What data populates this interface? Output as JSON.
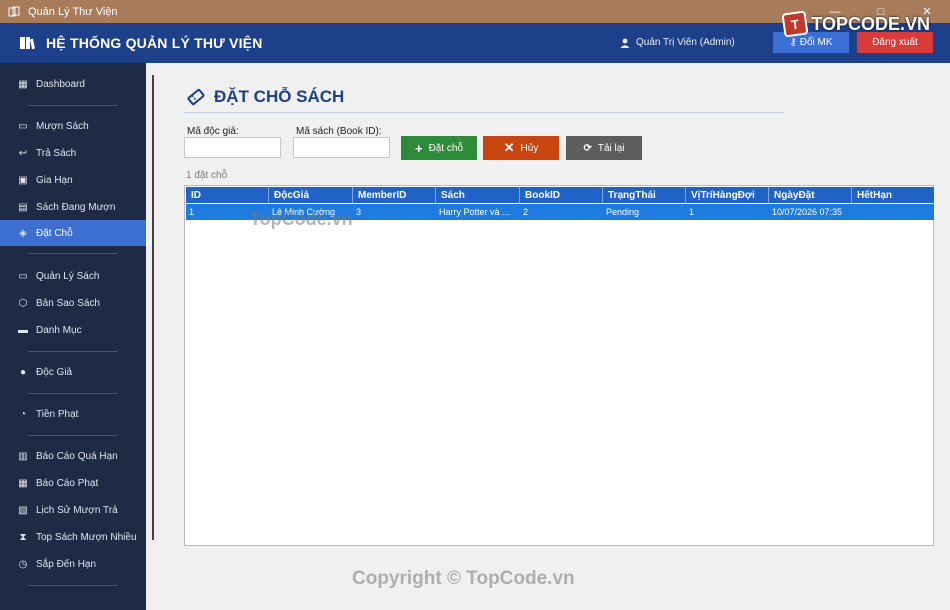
{
  "window": {
    "title": "Quản Lý Thư Viện",
    "controls": [
      "—",
      "□",
      "✕"
    ]
  },
  "brand": {
    "logo_text": "TOPCODE.VN"
  },
  "header": {
    "title": "HỆ THỐNG QUẢN LÝ THƯ VIỆN",
    "user_label": "Quản Trị Viên  (Admin)",
    "change_pw_label": "Đổi MK",
    "logout_label": "Đăng xuất"
  },
  "sidebar": {
    "items": [
      {
        "label": "Dashboard",
        "icon": "chart-icon"
      },
      {
        "label": "Mượn Sách",
        "icon": "book-icon"
      },
      {
        "label": "Trả Sách",
        "icon": "return-icon"
      },
      {
        "label": "Gia Hạn",
        "icon": "calendar-icon"
      },
      {
        "label": "Sách Đang Mượn",
        "icon": "list-icon"
      },
      {
        "label": "Đặt Chỗ",
        "icon": "ticket-icon",
        "active": true
      },
      {
        "label": "Quản Lý Sách",
        "icon": "book-icon"
      },
      {
        "label": "Bản Sao Sách",
        "icon": "box-icon"
      },
      {
        "label": "Danh Mục",
        "icon": "folder-icon"
      },
      {
        "label": "Độc Giả",
        "icon": "user-icon"
      },
      {
        "label": "Tiền Phạt",
        "icon": "stopwatch-icon"
      },
      {
        "label": "Báo Cáo Quá Hạn",
        "icon": "report-icon"
      },
      {
        "label": "Báo Cáo Phạt",
        "icon": "chart-icon"
      },
      {
        "label": "Lịch Sử Mượn Trả",
        "icon": "history-icon"
      },
      {
        "label": "Top Sách Mượn Nhiều",
        "icon": "trophy-icon"
      },
      {
        "label": "Sắp Đến Hạn",
        "icon": "alarm-icon"
      }
    ]
  },
  "main": {
    "title": "ĐẶT CHỖ SÁCH",
    "reader_label": "Mã độc giả:",
    "reader_value": "",
    "book_label": "Mã sách (Book ID):",
    "book_value": "",
    "add_label": "Đặt chỗ",
    "cancel_label": "Hủy",
    "reload_label": "Tải lại",
    "count_text": "1 đặt chỗ"
  },
  "table": {
    "columns": [
      "ID",
      "ĐộcGiả",
      "MemberID",
      "Sách",
      "BookID",
      "TrạngThái",
      "VịTríHàngĐợi",
      "NgàyĐặt",
      "HếtHạn"
    ],
    "rows": [
      [
        "1",
        "Lê Minh Cường",
        "3",
        "Harry Potter và ...",
        "2",
        "Pending",
        "1",
        "10/07/2026 07:35",
        ""
      ]
    ]
  },
  "watermarks": {
    "overlay": "TopCode.vn",
    "copyright": "Copyright © TopCode.vn"
  },
  "colors": {
    "header_bg": "#1e3f8a",
    "sidebar_bg": "#1f2a44",
    "active": "#3d6fd0",
    "add": "#2e8b3a",
    "cancel": "#c9440f",
    "reload": "#5d5d5d",
    "logout": "#d93a3a"
  }
}
